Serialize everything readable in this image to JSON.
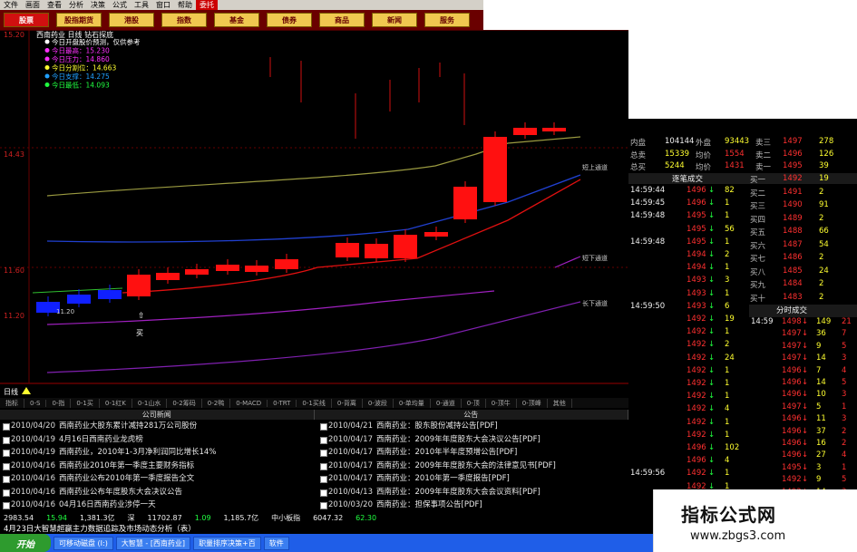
{
  "menubar": [
    "文件",
    "画面",
    "查看",
    "分析",
    "决策",
    "公式",
    "工具",
    "窗口",
    "帮助"
  ],
  "menubar_highlight": "委托",
  "nav": [
    "股票",
    "股指期货",
    "港股",
    "指数",
    "基金",
    "债券",
    "商品",
    "新闻",
    "服务"
  ],
  "chart": {
    "title": "西南药业 日线 钻石探底",
    "legend": [
      {
        "text": "今日开盘股价预测，仅供参考",
        "color": "#ffffff"
      },
      {
        "text": "今日最高：15.230",
        "color": "#ff30ff"
      },
      {
        "text": "今日压力：14.860",
        "color": "#ff30ff"
      },
      {
        "text": "今日分割位：14.663",
        "color": "#ffff30"
      },
      {
        "text": "今日支撑：14.275",
        "color": "#20a0ff"
      },
      {
        "text": "今日最低：14.093",
        "color": "#20ff40"
      }
    ],
    "yticks": [
      "15.20",
      "14.43",
      "11.60",
      "11.20"
    ],
    "channel_labels": [
      "短上通道",
      "短下通道",
      "长下通道"
    ],
    "buy_label": "买",
    "min_label": "11.20",
    "sub_label": "日线"
  },
  "indicator_tabs": [
    "指标",
    "0-S",
    "0-指",
    "0-1买",
    "0-1红K",
    "0-1山水",
    "0-2筹码",
    "0-2鸭",
    "0-MACD",
    "0-TRT",
    "0-1买线",
    "0-背离",
    "0-波段",
    "0-单均量",
    "0-通道",
    "0-顶",
    "0-顶牛",
    "0-顶峰",
    "其他"
  ],
  "news_left_header": "公司新闻",
  "news_right_header": "公告",
  "news_left": [
    {
      "date": "2010/04/20",
      "text": "西南药业大股东累计减持281万公司股份"
    },
    {
      "date": "2010/04/19",
      "text": "4月16日西南药业龙虎榜"
    },
    {
      "date": "2010/04/19",
      "text": "西南药业，2010年1-3月净利润同比增长14%"
    },
    {
      "date": "2010/04/16",
      "text": "西南药业2010年第一季度主要财务指标"
    },
    {
      "date": "2010/04/16",
      "text": "西南药业公布2010年第一季度报告全文"
    },
    {
      "date": "2010/04/16",
      "text": "西南药业公布年度股东大会决议公告"
    },
    {
      "date": "2010/04/16",
      "text": "04月16日西南药业涉停一天"
    }
  ],
  "news_right": [
    {
      "date": "2010/04/21",
      "text": "西南药业：股东股份减持公告[PDF]"
    },
    {
      "date": "2010/04/17",
      "text": "西南药业：2009年年度股东大会决议公告[PDF]"
    },
    {
      "date": "2010/04/17",
      "text": "西南药业：2010年半年度预增公告[PDF]"
    },
    {
      "date": "2010/04/17",
      "text": "西南药业：2009年年度股东大会的法律意见书[PDF]"
    },
    {
      "date": "2010/04/17",
      "text": "西南药业：2010年第一季度报告[PDF]"
    },
    {
      "date": "2010/04/13",
      "text": "西南药业：2009年年度股东大会会议资料[PDF]"
    },
    {
      "date": "2010/03/20",
      "text": "西南药业：担保事项公告[PDF]"
    }
  ],
  "stats": [
    {
      "l1": "内盘",
      "v1": "104144",
      "l2": "外盘",
      "v2": "93443"
    },
    {
      "l1": "总卖",
      "v1": "15339",
      "l2": "均价",
      "v2": "1554"
    },
    {
      "l1": "总买",
      "v1": "5244",
      "l2": "均价",
      "v2": "1431"
    }
  ],
  "asks": [
    {
      "label": "卖三",
      "price": "1497",
      "vol": "278"
    },
    {
      "label": "卖二",
      "price": "1496",
      "vol": "126"
    },
    {
      "label": "卖一",
      "price": "1495",
      "vol": "39"
    }
  ],
  "bids": [
    {
      "label": "买一",
      "price": "1492",
      "vol": "19"
    },
    {
      "label": "买二",
      "price": "1491",
      "vol": "2"
    },
    {
      "label": "买三",
      "price": "1490",
      "vol": "91"
    },
    {
      "label": "买四",
      "price": "1489",
      "vol": "2"
    },
    {
      "label": "买五",
      "price": "1488",
      "vol": "66"
    },
    {
      "label": "买六",
      "price": "1487",
      "vol": "54"
    },
    {
      "label": "买七",
      "price": "1486",
      "vol": "2"
    },
    {
      "label": "买八",
      "price": "1485",
      "vol": "24"
    },
    {
      "label": "买九",
      "price": "1484",
      "vol": "2"
    },
    {
      "label": "买十",
      "price": "1483",
      "vol": "2"
    }
  ],
  "trades_header": "逐笔成交",
  "trades": [
    {
      "time": "14:59:44",
      "price": "1496",
      "dir": "down",
      "vol": "82"
    },
    {
      "time": "14:59:45",
      "price": "1496",
      "dir": "down",
      "vol": "1"
    },
    {
      "time": "14:59:48",
      "price": "1495",
      "dir": "down",
      "vol": "1"
    },
    {
      "time": "",
      "price": "1495",
      "dir": "down",
      "vol": "56"
    },
    {
      "time": "14:59:48",
      "price": "1495",
      "dir": "down",
      "vol": "1"
    },
    {
      "time": "",
      "price": "1494",
      "dir": "down",
      "vol": "2"
    },
    {
      "time": "",
      "price": "1494",
      "dir": "down",
      "vol": "1"
    },
    {
      "time": "",
      "price": "1493",
      "dir": "down",
      "vol": "3"
    },
    {
      "time": "",
      "price": "1493",
      "dir": "down",
      "vol": "1"
    },
    {
      "time": "14:59:50",
      "price": "1493",
      "dir": "down",
      "vol": "6"
    },
    {
      "time": "",
      "price": "1492",
      "dir": "down",
      "vol": "19"
    },
    {
      "time": "",
      "price": "1492",
      "dir": "down",
      "vol": "1"
    },
    {
      "time": "",
      "price": "1492",
      "dir": "down",
      "vol": "2"
    },
    {
      "time": "",
      "price": "1492",
      "dir": "down",
      "vol": "24"
    },
    {
      "time": "",
      "price": "1492",
      "dir": "down",
      "vol": "1"
    },
    {
      "time": "",
      "price": "1492",
      "dir": "down",
      "vol": "1"
    },
    {
      "time": "",
      "price": "1492",
      "dir": "down",
      "vol": "1"
    },
    {
      "time": "",
      "price": "1492",
      "dir": "down",
      "vol": "4"
    },
    {
      "time": "",
      "price": "1492",
      "dir": "down",
      "vol": "1"
    },
    {
      "time": "",
      "price": "1492",
      "dir": "down",
      "vol": "1"
    },
    {
      "time": "",
      "price": "1496",
      "dir": "down",
      "vol": "102"
    },
    {
      "time": "",
      "price": "1496",
      "dir": "down",
      "vol": "4"
    },
    {
      "time": "14:59:56",
      "price": "1492",
      "dir": "down",
      "vol": "1"
    },
    {
      "time": "",
      "price": "1492",
      "dir": "down",
      "vol": "1"
    },
    {
      "time": "",
      "price": "1492",
      "dir": "down",
      "vol": "1"
    },
    {
      "time": "",
      "price": "1492",
      "dir": "down",
      "vol": "2"
    }
  ],
  "time_trades_header": "分时成交",
  "time_trades": [
    {
      "time": "14:59",
      "price": "1498",
      "vol": "149",
      "num": "21"
    },
    {
      "time": "",
      "price": "1497",
      "vol": "36",
      "num": "7"
    },
    {
      "time": "",
      "price": "1497",
      "vol": "9",
      "num": "5"
    },
    {
      "time": "",
      "price": "1497",
      "vol": "14",
      "num": "3"
    },
    {
      "time": "",
      "price": "1496",
      "vol": "7",
      "num": "4"
    },
    {
      "time": "",
      "price": "1496",
      "vol": "14",
      "num": "5"
    },
    {
      "time": "",
      "price": "1496",
      "vol": "10",
      "num": "3"
    },
    {
      "time": "",
      "price": "1497",
      "vol": "5",
      "num": "1"
    },
    {
      "time": "",
      "price": "1496",
      "vol": "11",
      "num": "3"
    },
    {
      "time": "",
      "price": "1496",
      "vol": "37",
      "num": "2"
    },
    {
      "time": "",
      "price": "1496",
      "vol": "16",
      "num": "2"
    },
    {
      "time": "",
      "price": "1496",
      "vol": "27",
      "num": "4"
    },
    {
      "time": "",
      "price": "1495",
      "vol": "3",
      "num": "1"
    },
    {
      "time": "",
      "price": "1492",
      "vol": "9",
      "num": "5"
    },
    {
      "time": "",
      "price": "1492",
      "vol": "14",
      "num": "3"
    },
    {
      "time": "15:00",
      "price": "1492",
      "vol": "31",
      "num": "6"
    }
  ],
  "status": {
    "sh_index": "2983.54",
    "sh_change": "15.94",
    "sh_amount": "1,381.3亿",
    "sh_label": "深",
    "sz_index": "11702.87",
    "sz_change": "1.09",
    "sz_amount": "1,185.7亿",
    "board_label": "中小板指",
    "small_index": "6047.32",
    "small_change": "62.30"
  },
  "ticker": "4月23日大智慧超赢主力数据追踪及市场动态分析（表）",
  "taskbar": {
    "start": "开始",
    "tasks": [
      "可移动磁盘 (I:)",
      "大智慧 - [西南药业]",
      "职量排序决策+百",
      "软件"
    ]
  },
  "brand": {
    "title": "指标公式网",
    "url": "www.zbgs3.com"
  }
}
